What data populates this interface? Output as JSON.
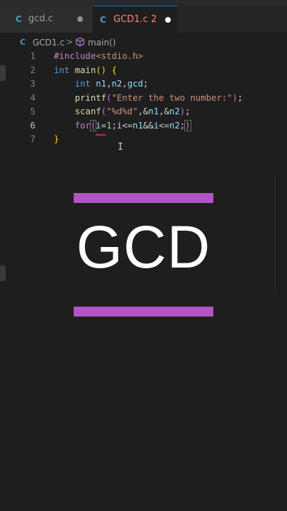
{
  "tabs": [
    {
      "icon": "C",
      "label": "gcd.c",
      "modified": true,
      "active": false
    },
    {
      "icon": "C",
      "label": "GCD1.c",
      "problems": "2",
      "modified": true,
      "active": true
    }
  ],
  "breadcrumb": {
    "file": "GCD1.c",
    "separator": ">",
    "symbol": "main()"
  },
  "editor": {
    "active_line": 6,
    "lines": [
      {
        "number": "1",
        "text": "#include<stdio.h>"
      },
      {
        "number": "2",
        "text": "int main() {"
      },
      {
        "number": "3",
        "text": "    int n1,n2,gcd;"
      },
      {
        "number": "4",
        "text": "    printf(\"Enter the two number:\");"
      },
      {
        "number": "5",
        "text": "    scanf(\"%d%d\",&n1,&n2);"
      },
      {
        "number": "6",
        "text": "    for(i=1;i<=n1&&i<=n2;)"
      },
      {
        "number": "7",
        "text": "}"
      }
    ]
  },
  "overlay": {
    "title": "GCD",
    "bar_color": "#b452c8"
  },
  "colors": {
    "tab_error": "#f48771",
    "keyword": "#569cd6",
    "string": "#ce9178"
  }
}
